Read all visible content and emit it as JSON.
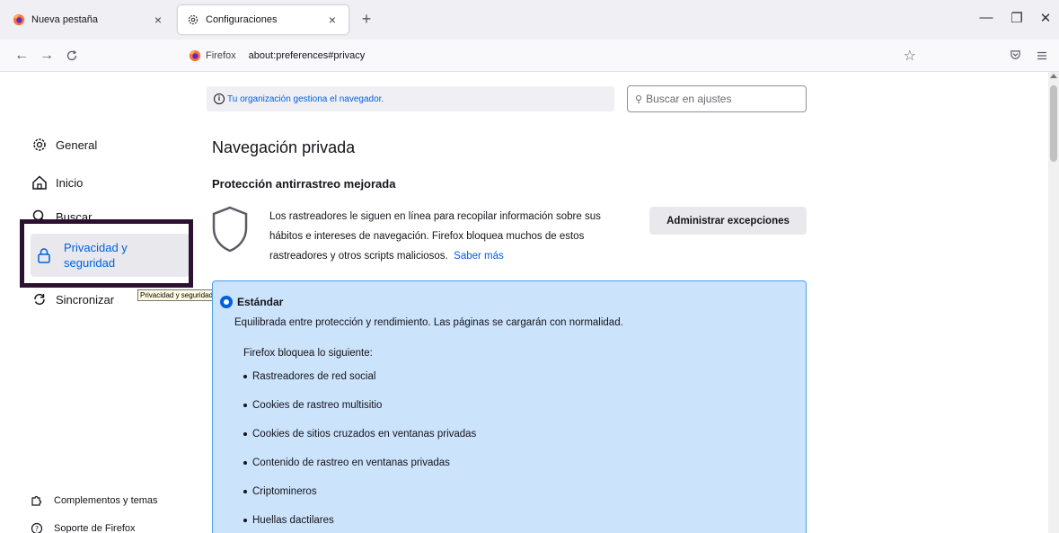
{
  "tabs": [
    {
      "title": "Nueva pestaña",
      "icon": "firefox-icon",
      "active": false
    },
    {
      "title": "Configuraciones",
      "icon": "gear-icon",
      "active": true
    }
  ],
  "window_controls": {
    "minimize": "—",
    "restore": "❐",
    "close": "✕"
  },
  "navbar": {
    "identity_label": "Firefox",
    "url": "about:preferences#privacy"
  },
  "policy_notice": "Tu organización gestiona el navegador.",
  "search": {
    "placeholder": "Buscar en ajustes"
  },
  "sidebar": {
    "items": [
      {
        "label": "General",
        "icon": "gear-icon"
      },
      {
        "label": "Inicio",
        "icon": "home-icon"
      },
      {
        "label": "Buscar",
        "icon": "search-icon"
      },
      {
        "label": "Privacidad y\nseguridad",
        "line1": "Privacidad y",
        "line2": "seguridad",
        "icon": "lock-icon",
        "selected": true
      },
      {
        "label": "Sincronizar",
        "icon": "sync-icon"
      }
    ],
    "tooltip": "Privacidad y seguridad",
    "footer": [
      {
        "label": "Complementos y temas",
        "icon": "puzzle-icon"
      },
      {
        "label": "Soporte de Firefox",
        "icon": "help-icon"
      }
    ]
  },
  "main": {
    "page_title": "Navegación privada",
    "etp_title": "Protección antirrastreo mejorada",
    "etp_line1": "Los rastreadores le siguen en línea para recopilar información sobre sus",
    "etp_line2": "hábitos e intereses de navegación. Firefox bloquea muchos de estos",
    "etp_line3": "rastreadores y otros scripts maliciosos.",
    "learn_more": "Saber más",
    "manage_button": "Administrar excepciones",
    "standard": {
      "title": "Estándar",
      "description": "Equilibrada entre protección y rendimiento. Las páginas se cargarán con normalidad.",
      "blocks_title": "Firefox bloquea lo siguiente:",
      "items": [
        "Rastreadores de red social",
        "Cookies de rastreo multisitio",
        "Cookies de sitios cruzados en ventanas privadas",
        "Contenido de rastreo en ventanas privadas",
        "Criptomineros",
        "Huellas dactilares"
      ]
    }
  },
  "colors": {
    "accent": "#0060df",
    "highlight_box": "#2c1230",
    "standard_panel": "#cbe3fb"
  }
}
